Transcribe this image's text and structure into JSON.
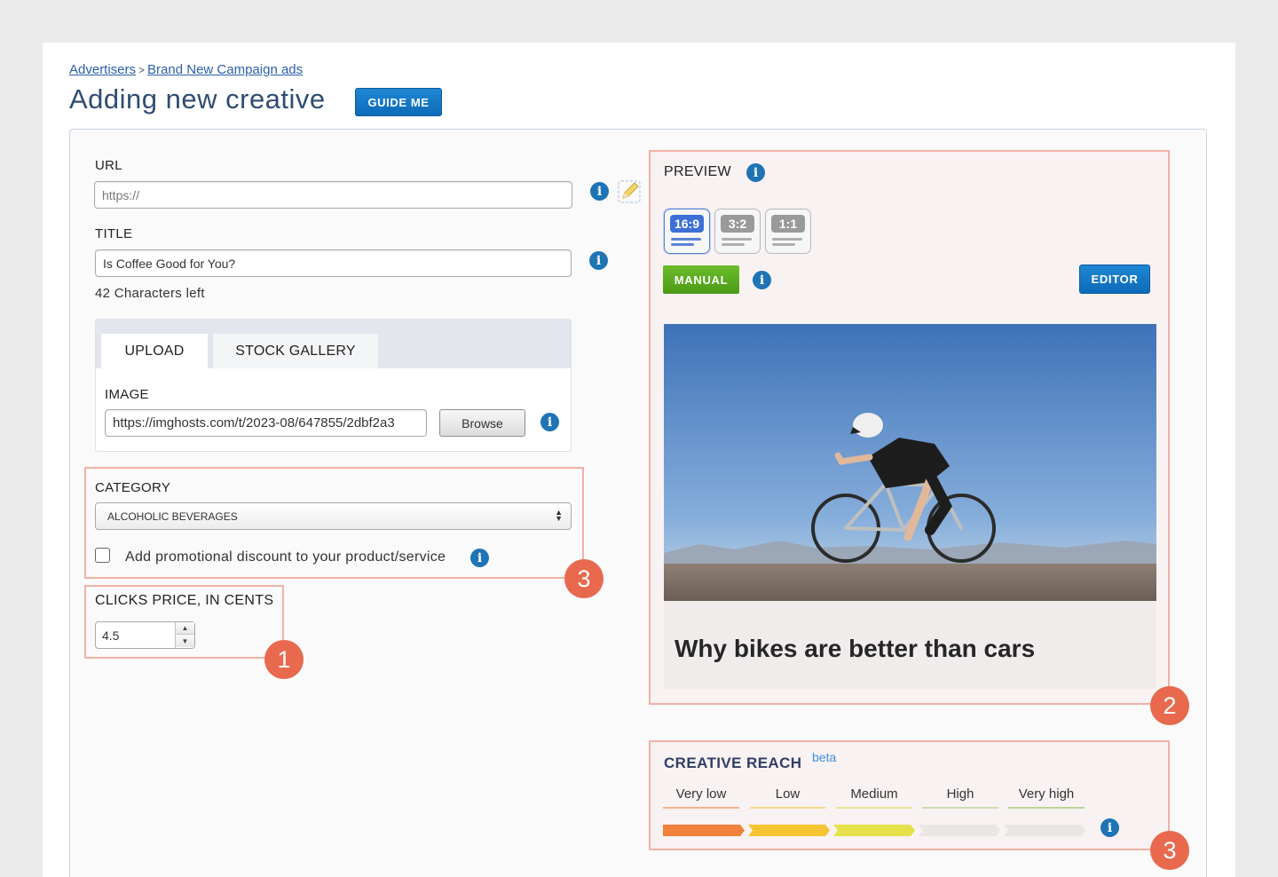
{
  "breadcrumb": {
    "advertisers": "Advertisers",
    "separator": ">",
    "campaign": "Brand New Campaign ads"
  },
  "page": {
    "title": "Adding new creative",
    "guide_button": "GUIDE ME"
  },
  "form": {
    "url": {
      "label": "URL",
      "placeholder": "https://",
      "value": ""
    },
    "title": {
      "label": "TITLE",
      "value": "Is Coffee Good for You?",
      "chars_left": "42 Characters left"
    },
    "tabs": [
      {
        "label": "UPLOAD",
        "active": true
      },
      {
        "label": "STOCK GALLERY",
        "active": false
      }
    ],
    "image": {
      "label": "IMAGE",
      "value": "https://imghosts.com/t/2023-08/647855/2dbf2a3",
      "browse_label": "Browse"
    },
    "category": {
      "label": "CATEGORY",
      "selected": "ALCOHOLIC BEVERAGES"
    },
    "discount": {
      "label": "Add promotional discount to your product/service",
      "checked": false
    },
    "clicks_price": {
      "label": "CLICKS PRICE, IN CENTS",
      "value": "4.5"
    }
  },
  "preview": {
    "label": "PREVIEW",
    "ratios": [
      {
        "label": "16:9",
        "active": true
      },
      {
        "label": "3:2",
        "active": false
      },
      {
        "label": "1:1",
        "active": false
      }
    ],
    "manual_button": "MANUAL",
    "editor_button": "EDITOR",
    "caption": "Why bikes are better than cars"
  },
  "reach": {
    "title": "CREATIVE REACH",
    "beta": "beta",
    "levels": [
      "Very low",
      "Low",
      "Medium",
      "High",
      "Very high"
    ],
    "level_colors": [
      "#f0803c",
      "#f5c431",
      "#e4e14a",
      "#e9e6e3",
      "#e9e6e3"
    ],
    "underline_colors": [
      "#f3b28c",
      "#f4d98c",
      "#e8e599",
      "#c9deb0",
      "#b9d49a"
    ],
    "current_level": 3
  },
  "annotations": [
    "1",
    "2",
    "3",
    "3"
  ],
  "colors": {
    "accent": "#1e74b5",
    "highlight": "#f0b2a4",
    "badge": "#e8694e",
    "manual": "#5aa91f"
  },
  "icons": [
    "info-icon",
    "pencil-icon"
  ]
}
